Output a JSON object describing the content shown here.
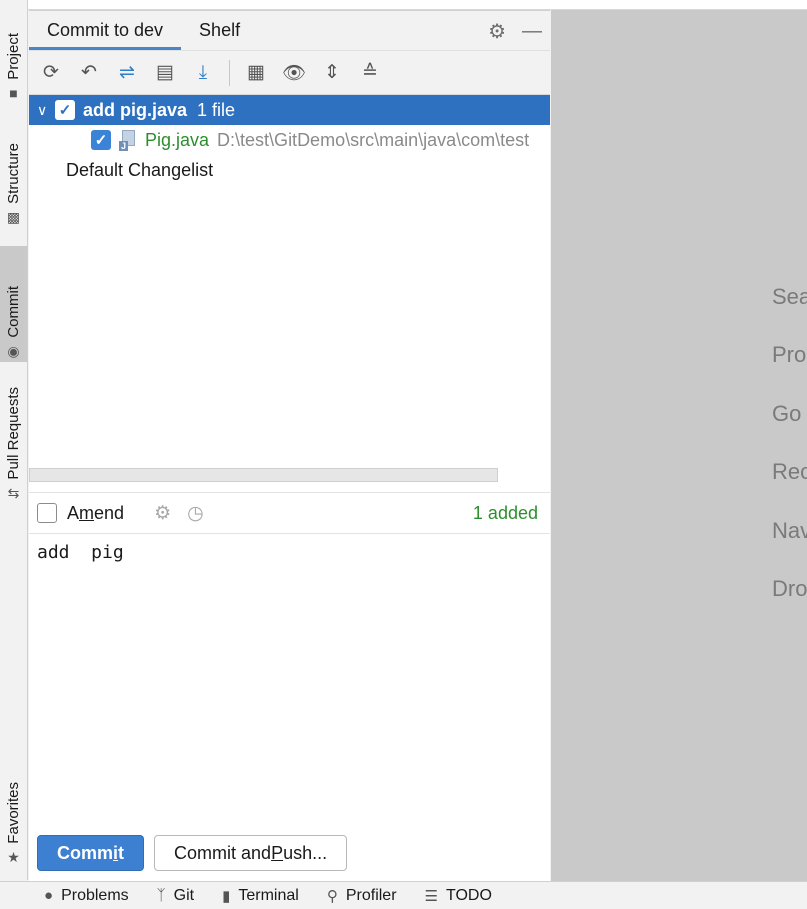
{
  "side_tabs": [
    {
      "label": "Project",
      "icon": "folder-icon"
    },
    {
      "label": "Structure",
      "icon": "structure-icon"
    },
    {
      "label": "Commit",
      "icon": "commit-icon"
    },
    {
      "label": "Pull Requests",
      "icon": "pull-request-icon"
    },
    {
      "label": "Favorites",
      "icon": "star-icon"
    }
  ],
  "panel": {
    "tabs": [
      {
        "label": "Commit to dev",
        "active": true
      },
      {
        "label": "Shelf",
        "active": false
      }
    ],
    "toolbar_icons": [
      "refresh-icon",
      "rollback-icon",
      "diff-icon",
      "changelist-icon",
      "update-icon",
      "group-by-icon",
      "view-options-icon",
      "expand-all-icon",
      "collapse-all-icon"
    ],
    "tree": {
      "changelist": {
        "title": "add pig.java",
        "count": "1 file"
      },
      "file": {
        "name": "Pig.java",
        "path": "D:\\test\\GitDemo\\src\\main\\java\\com\\test"
      },
      "default_changelist": "Default Changelist"
    },
    "amend": {
      "label_before": "A",
      "label_mnemonic": "m",
      "label_after": "end",
      "checked": false
    },
    "added_summary": "1 added",
    "commit_message": "add  pig",
    "buttons": {
      "commit_before": "Commit",
      "commit_mnemonic": "",
      "commit_label_a": "Comm",
      "commit_label_u": "i",
      "commit_label_b": "t",
      "push_label_a": "Commit and ",
      "push_label_u": "P",
      "push_label_b": "ush..."
    }
  },
  "editor_hints": [
    "Sea",
    "Pro",
    "Go",
    "Rec",
    "Nav",
    "Dro"
  ],
  "statusbar": [
    {
      "label": "Problems",
      "icon": "problems-icon"
    },
    {
      "label": "Git",
      "icon": "git-branch-icon"
    },
    {
      "label": "Terminal",
      "icon": "terminal-icon"
    },
    {
      "label": "Profiler",
      "icon": "profiler-icon"
    },
    {
      "label": "TODO",
      "icon": "todo-icon"
    }
  ],
  "colors": {
    "accent": "#2f71c1",
    "added": "#2c8f2c",
    "path": "#8a8a8a"
  }
}
